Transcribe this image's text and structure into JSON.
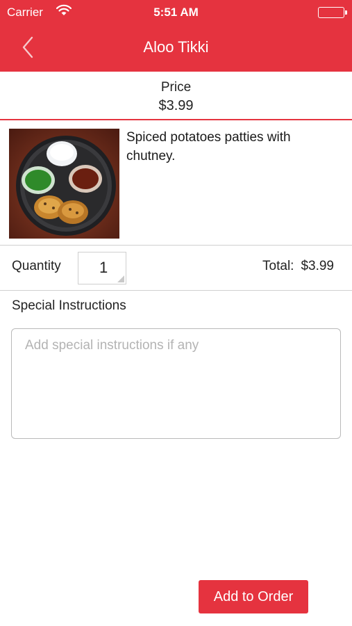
{
  "status_bar": {
    "carrier": "Carrier",
    "time": "5:51 AM",
    "icons": [
      "wifi-icon",
      "battery-icon"
    ]
  },
  "nav": {
    "title": "Aloo Tikki",
    "back_icon": "chevron-left-icon"
  },
  "item": {
    "price_label": "Price",
    "price_value": "$3.99",
    "description": "Spiced potatoes patties with chutney."
  },
  "order": {
    "quantity_label": "Quantity",
    "quantity_value": "1",
    "total_label": "Total:",
    "total_value": "$3.99"
  },
  "instructions": {
    "label": "Special Instructions",
    "placeholder": "Add special instructions if any",
    "value": ""
  },
  "actions": {
    "add_label": "Add to Order"
  },
  "colors": {
    "accent": "#e5333f",
    "divider": "#cfcfcf",
    "placeholder": "#b3b3b3"
  }
}
